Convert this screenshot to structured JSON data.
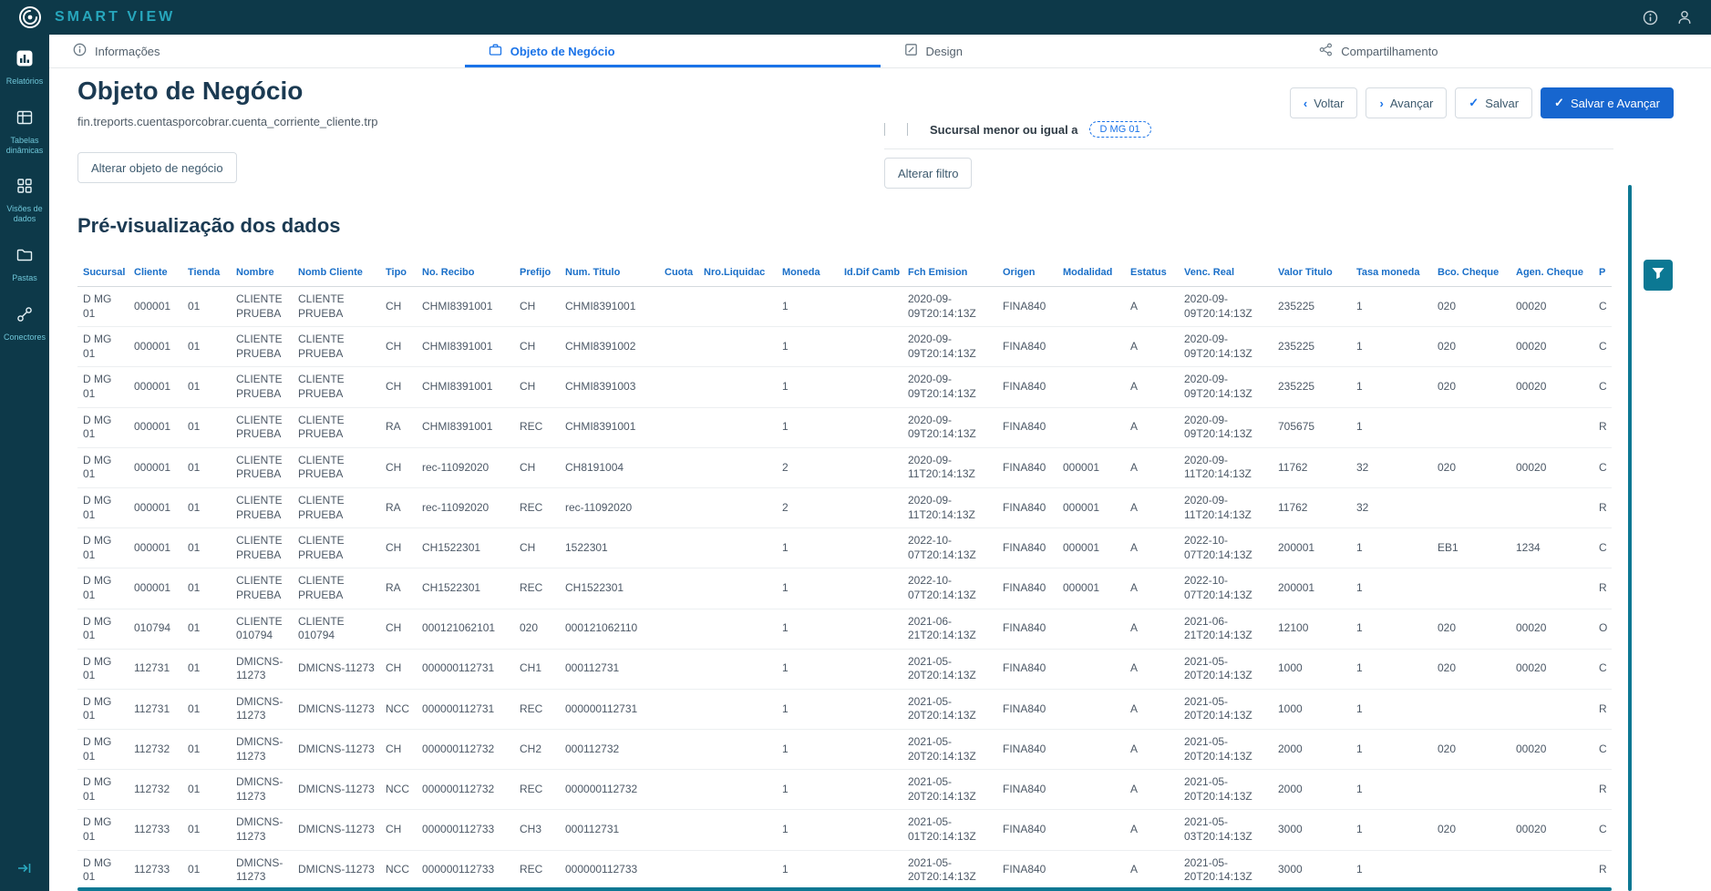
{
  "topbar": {
    "brand": "SMART VIEW"
  },
  "sidebar": {
    "items": [
      {
        "label": "Relatórios"
      },
      {
        "label": "Tabelas dinâmicas"
      },
      {
        "label": "Visões de dados"
      },
      {
        "label": "Pastas"
      },
      {
        "label": "Conectores"
      }
    ]
  },
  "tabs": [
    {
      "label": "Informações"
    },
    {
      "label": "Objeto de Negócio"
    },
    {
      "label": "Design"
    },
    {
      "label": "Compartilhamento"
    }
  ],
  "page": {
    "title": "Objeto de Negócio",
    "subtitle": "fin.treports.cuentasporcobrar.cuenta_corriente_cliente.trp",
    "preview_title": "Pré-visualização dos dados"
  },
  "actions": {
    "back": "Voltar",
    "forward": "Avançar",
    "save": "Salvar",
    "save_forward": "Salvar e Avançar",
    "change_object": "Alterar objeto de negócio",
    "change_filter": "Alterar filtro"
  },
  "filter": {
    "summary": "Sucursal menor ou igual a",
    "chip": "D MG 01"
  },
  "table": {
    "columns": [
      "Sucursal",
      "Cliente",
      "Tienda",
      "Nombre",
      "Nomb Cliente",
      "Tipo",
      "No. Recibo",
      "Prefijo",
      "Num. Titulo",
      "Cuota",
      "Nro.Liquidac",
      "Moneda",
      "Id.Dif Camb",
      "Fch Emision",
      "Origen",
      "Modalidad",
      "Estatus",
      "Venc. Real",
      "Valor Titulo",
      "Tasa moneda",
      "Bco. Cheque",
      "Agen. Cheque",
      "P"
    ],
    "rows": [
      [
        "D MG 01",
        "000001",
        "01",
        "CLIENTE PRUEBA",
        "CLIENTE PRUEBA",
        "CH",
        "CHMI8391001",
        "CH",
        "CHMI8391001",
        "",
        "",
        "1",
        "",
        "2020-09-09T20:14:13Z",
        "FINA840",
        "",
        "A",
        "2020-09-09T20:14:13Z",
        "235225",
        "1",
        "020",
        "00020",
        "C"
      ],
      [
        "D MG 01",
        "000001",
        "01",
        "CLIENTE PRUEBA",
        "CLIENTE PRUEBA",
        "CH",
        "CHMI8391001",
        "CH",
        "CHMI8391002",
        "",
        "",
        "1",
        "",
        "2020-09-09T20:14:13Z",
        "FINA840",
        "",
        "A",
        "2020-09-09T20:14:13Z",
        "235225",
        "1",
        "020",
        "00020",
        "C"
      ],
      [
        "D MG 01",
        "000001",
        "01",
        "CLIENTE PRUEBA",
        "CLIENTE PRUEBA",
        "CH",
        "CHMI8391001",
        "CH",
        "CHMI8391003",
        "",
        "",
        "1",
        "",
        "2020-09-09T20:14:13Z",
        "FINA840",
        "",
        "A",
        "2020-09-09T20:14:13Z",
        "235225",
        "1",
        "020",
        "00020",
        "C"
      ],
      [
        "D MG 01",
        "000001",
        "01",
        "CLIENTE PRUEBA",
        "CLIENTE PRUEBA",
        "RA",
        "CHMI8391001",
        "REC",
        "CHMI8391001",
        "",
        "",
        "1",
        "",
        "2020-09-09T20:14:13Z",
        "FINA840",
        "",
        "A",
        "2020-09-09T20:14:13Z",
        "705675",
        "1",
        "",
        "",
        "R"
      ],
      [
        "D MG 01",
        "000001",
        "01",
        "CLIENTE PRUEBA",
        "CLIENTE PRUEBA",
        "CH",
        "rec-11092020",
        "CH",
        "CH8191004",
        "",
        "",
        "2",
        "",
        "2020-09-11T20:14:13Z",
        "FINA840",
        "000001",
        "A",
        "2020-09-11T20:14:13Z",
        "11762",
        "32",
        "020",
        "00020",
        "C"
      ],
      [
        "D MG 01",
        "000001",
        "01",
        "CLIENTE PRUEBA",
        "CLIENTE PRUEBA",
        "RA",
        "rec-11092020",
        "REC",
        "rec-11092020",
        "",
        "",
        "2",
        "",
        "2020-09-11T20:14:13Z",
        "FINA840",
        "000001",
        "A",
        "2020-09-11T20:14:13Z",
        "11762",
        "32",
        "",
        "",
        "R"
      ],
      [
        "D MG 01",
        "000001",
        "01",
        "CLIENTE PRUEBA",
        "CLIENTE PRUEBA",
        "CH",
        "CH1522301",
        "CH",
        "1522301",
        "",
        "",
        "1",
        "",
        "2022-10-07T20:14:13Z",
        "FINA840",
        "000001",
        "A",
        "2022-10-07T20:14:13Z",
        "200001",
        "1",
        "EB1",
        "1234",
        "C"
      ],
      [
        "D MG 01",
        "000001",
        "01",
        "CLIENTE PRUEBA",
        "CLIENTE PRUEBA",
        "RA",
        "CH1522301",
        "REC",
        "CH1522301",
        "",
        "",
        "1",
        "",
        "2022-10-07T20:14:13Z",
        "FINA840",
        "000001",
        "A",
        "2022-10-07T20:14:13Z",
        "200001",
        "1",
        "",
        "",
        "R"
      ],
      [
        "D MG 01",
        "010794",
        "01",
        "CLIENTE 010794",
        "CLIENTE 010794",
        "CH",
        "000121062101",
        "020",
        "000121062110",
        "",
        "",
        "1",
        "",
        "2021-06-21T20:14:13Z",
        "FINA840",
        "",
        "A",
        "2021-06-21T20:14:13Z",
        "12100",
        "1",
        "020",
        "00020",
        "O"
      ],
      [
        "D MG 01",
        "112731",
        "01",
        "DMICNS-11273",
        "DMICNS-11273",
        "CH",
        "000000112731",
        "CH1",
        "000112731",
        "",
        "",
        "1",
        "",
        "2021-05-20T20:14:13Z",
        "FINA840",
        "",
        "A",
        "2021-05-20T20:14:13Z",
        "1000",
        "1",
        "020",
        "00020",
        "C"
      ],
      [
        "D MG 01",
        "112731",
        "01",
        "DMICNS-11273",
        "DMICNS-11273",
        "NCC",
        "000000112731",
        "REC",
        "000000112731",
        "",
        "",
        "1",
        "",
        "2021-05-20T20:14:13Z",
        "FINA840",
        "",
        "A",
        "2021-05-20T20:14:13Z",
        "1000",
        "1",
        "",
        "",
        "R"
      ],
      [
        "D MG 01",
        "112732",
        "01",
        "DMICNS-11273",
        "DMICNS-11273",
        "CH",
        "000000112732",
        "CH2",
        "000112732",
        "",
        "",
        "1",
        "",
        "2021-05-20T20:14:13Z",
        "FINA840",
        "",
        "A",
        "2021-05-20T20:14:13Z",
        "2000",
        "1",
        "020",
        "00020",
        "C"
      ],
      [
        "D MG 01",
        "112732",
        "01",
        "DMICNS-11273",
        "DMICNS-11273",
        "NCC",
        "000000112732",
        "REC",
        "000000112732",
        "",
        "",
        "1",
        "",
        "2021-05-20T20:14:13Z",
        "FINA840",
        "",
        "A",
        "2021-05-20T20:14:13Z",
        "2000",
        "1",
        "",
        "",
        "R"
      ],
      [
        "D MG 01",
        "112733",
        "01",
        "DMICNS-11273",
        "DMICNS-11273",
        "CH",
        "000000112733",
        "CH3",
        "000112731",
        "",
        "",
        "1",
        "",
        "2021-05-01T20:14:13Z",
        "FINA840",
        "",
        "A",
        "2021-05-03T20:14:13Z",
        "3000",
        "1",
        "020",
        "00020",
        "C"
      ],
      [
        "D MG 01",
        "112733",
        "01",
        "DMICNS-11273",
        "DMICNS-11273",
        "NCC",
        "000000112733",
        "REC",
        "000000112733",
        "",
        "",
        "1",
        "",
        "2021-05-20T20:14:13Z",
        "FINA840",
        "",
        "A",
        "2021-05-20T20:14:13Z",
        "3000",
        "1",
        "",
        "",
        "R"
      ]
    ]
  },
  "colors": {
    "topbar_bg": "#0d3949",
    "brand_teal": "#27a6bc",
    "accent_blue": "#1a73e8",
    "primary_button": "#1766cf",
    "header_blue": "#1a6fc8",
    "title_navy": "#1b3a52",
    "scrollbar_teal": "#0c7893"
  }
}
